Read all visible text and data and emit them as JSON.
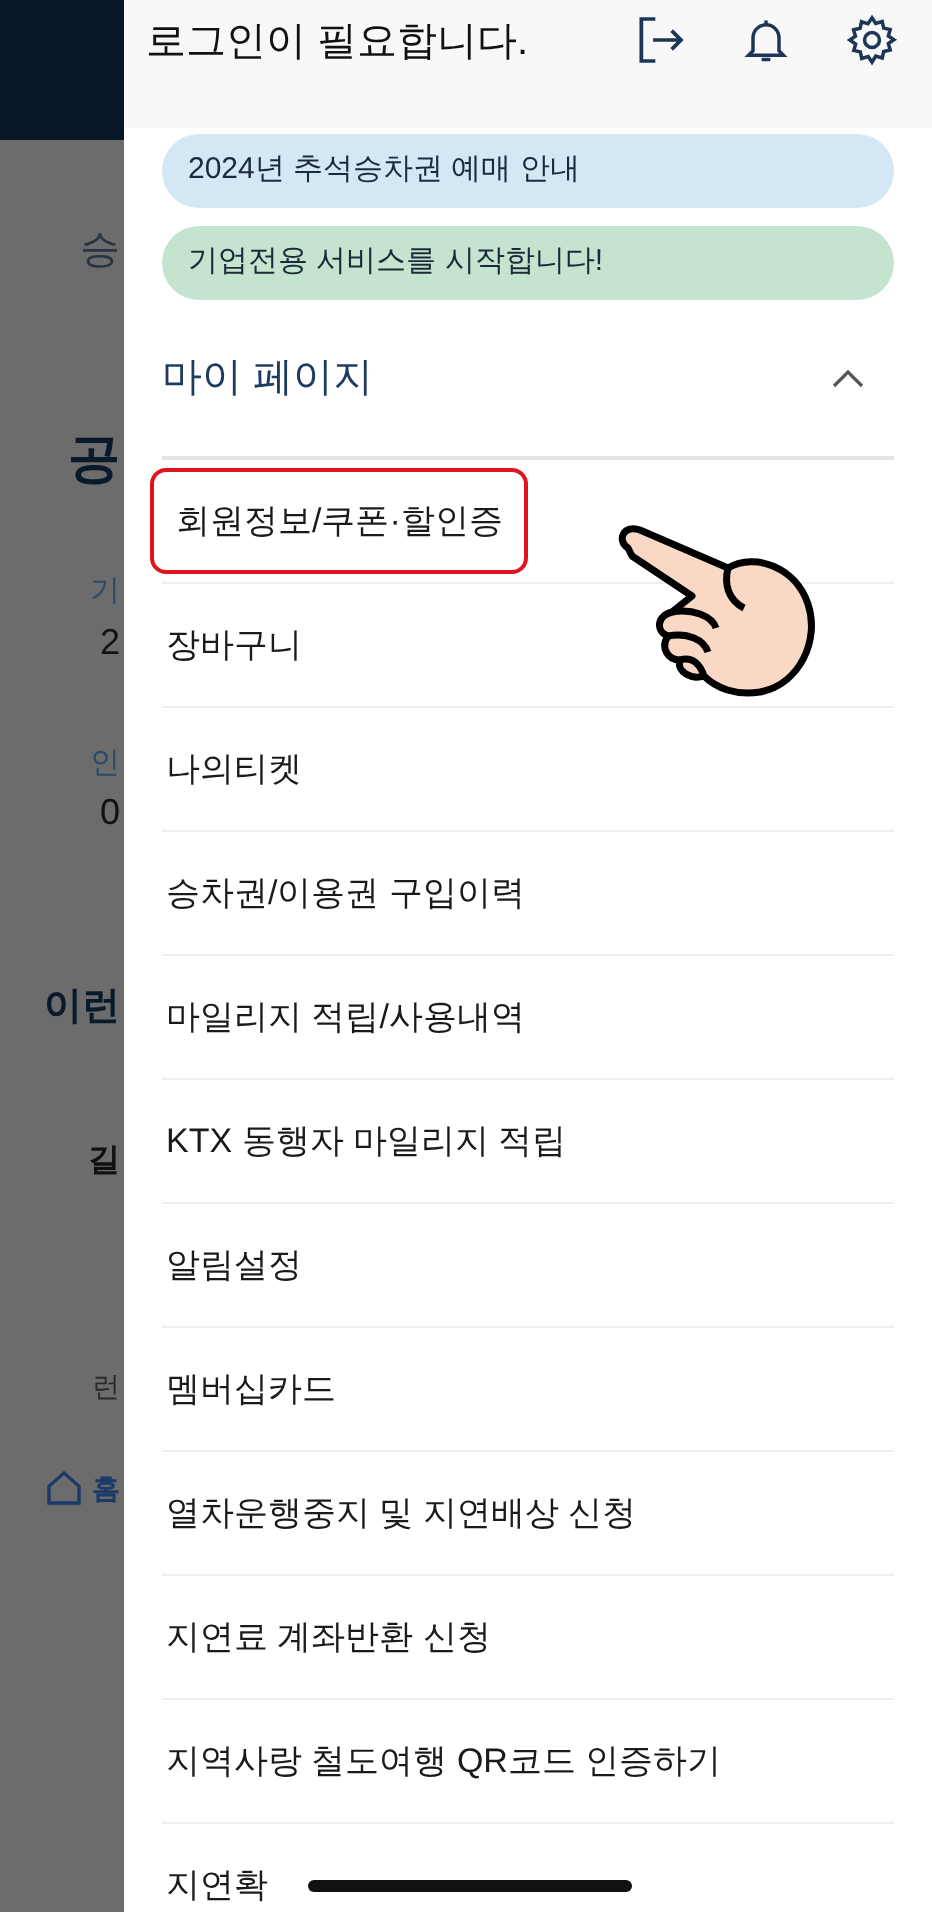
{
  "background": {
    "fragments": [
      {
        "text": "승",
        "kind": "title"
      },
      {
        "text": "공",
        "kind": "big"
      },
      {
        "text": "기",
        "kind": "label"
      },
      {
        "text": "2",
        "kind": "value"
      },
      {
        "text": "인",
        "kind": "label"
      },
      {
        "text": "0",
        "kind": "value"
      },
      {
        "text": "이런",
        "kind": "heading"
      },
      {
        "text": "길",
        "kind": "bold"
      },
      {
        "text": "런",
        "kind": "muted"
      },
      {
        "text": "홈",
        "kind": "nav"
      }
    ]
  },
  "drawer": {
    "header": {
      "title": "로그인이 필요합니다."
    },
    "banners": [
      {
        "text": "2024년 추석승차권 예매 안내",
        "color": "#d4e7f5"
      },
      {
        "text": "기업전용 서비스를 시작합니다!",
        "color": "#c5e4cf"
      }
    ],
    "section": {
      "title": "마이 페이지",
      "expanded": true
    },
    "items": [
      {
        "label": "회원정보/쿠폰·할인증",
        "highlighted": true
      },
      {
        "label": "장바구니",
        "highlighted": false
      },
      {
        "label": "나의티켓",
        "highlighted": false
      },
      {
        "label": "승차권/이용권 구입이력",
        "highlighted": false
      },
      {
        "label": "마일리지 적립/사용내역",
        "highlighted": false
      },
      {
        "label": "KTX 동행자 마일리지 적립",
        "highlighted": false
      },
      {
        "label": "알림설정",
        "highlighted": false
      },
      {
        "label": "멤버십카드",
        "highlighted": false
      },
      {
        "label": "열차운행중지 및 지연배상 신청",
        "highlighted": false
      },
      {
        "label": "지연료 계좌반환 신청",
        "highlighted": false
      },
      {
        "label": "지역사랑 철도여행 QR코드 인증하기",
        "highlighted": false
      },
      {
        "label": "지연확",
        "highlighted": false
      }
    ]
  }
}
